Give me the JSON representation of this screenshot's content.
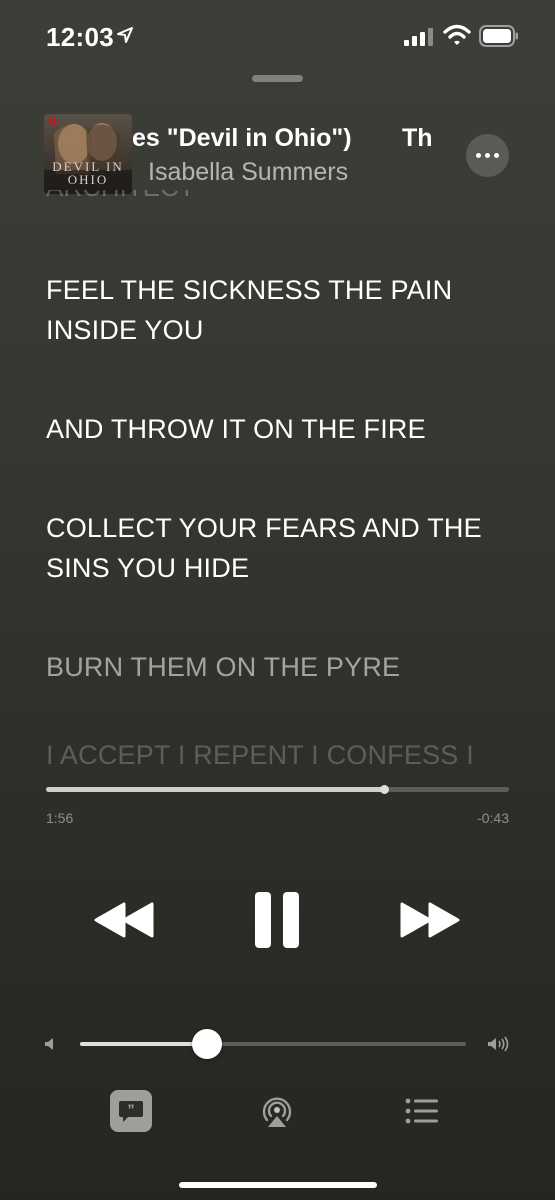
{
  "status_bar": {
    "time": "12:03",
    "location_icon": "location-arrow-icon",
    "signal_icon": "cellular-signal-icon",
    "wifi_icon": "wifi-icon",
    "battery_icon": "battery-icon"
  },
  "now_playing": {
    "artwork_text": "DEVIL IN OHIO",
    "artwork_logo": "N",
    "title_visible": "es \"Devil in Ohio\")",
    "title_next": "Th",
    "artist": "Isabella Summers",
    "previous_line_fragment": "ARCHITECT",
    "more_icon": "ellipsis-icon"
  },
  "lyrics": [
    {
      "text": "FEEL THE SICKNESS THE PAIN INSIDE YOU",
      "state": "active"
    },
    {
      "text": "AND THROW IT ON THE FIRE",
      "state": "active"
    },
    {
      "text": "COLLECT YOUR FEARS AND THE SINS YOU HIDE",
      "state": "active"
    },
    {
      "text": "BURN THEM ON THE PYRE",
      "state": "dim"
    },
    {
      "text": "I ACCEPT I REPENT I CONFESS I",
      "state": "faint"
    }
  ],
  "playback": {
    "elapsed": "1:56",
    "remaining": "-0:43",
    "progress_fraction": 0.73,
    "volume_fraction": 0.33,
    "rewind_icon": "rewind-icon",
    "pause_icon": "pause-icon",
    "forward_icon": "fast-forward-icon"
  },
  "toolbar": {
    "lyrics_icon": "lyrics-quote-icon",
    "airplay_icon": "airplay-audio-icon",
    "queue_icon": "queue-list-icon"
  },
  "colors": {
    "background_top": "#3e3e39",
    "background_bottom": "#262621",
    "text": "#ffffff"
  }
}
